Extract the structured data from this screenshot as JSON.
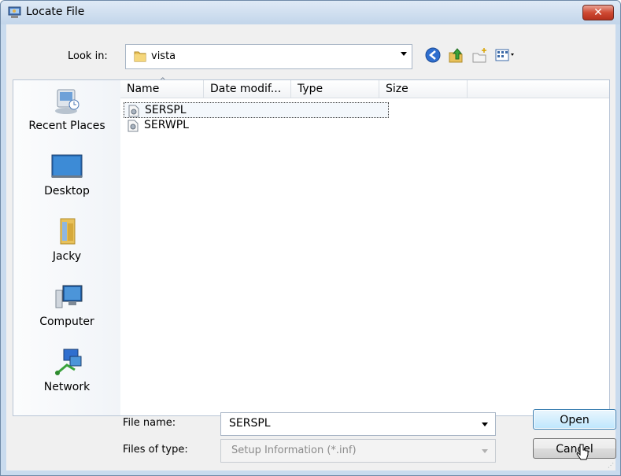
{
  "window": {
    "title": "Locate File",
    "close_label": "✕"
  },
  "toolbar": {
    "look_in_label": "Look in:",
    "look_in_value": "vista",
    "icons": [
      "back-icon",
      "up-folder-icon",
      "new-folder-icon",
      "views-menu-icon"
    ]
  },
  "places": [
    {
      "label": "Recent Places",
      "icon": "recent-places-icon"
    },
    {
      "label": "Desktop",
      "icon": "desktop-icon"
    },
    {
      "label": "Jacky",
      "icon": "user-folder-icon"
    },
    {
      "label": "Computer",
      "icon": "computer-icon"
    },
    {
      "label": "Network",
      "icon": "network-icon"
    }
  ],
  "list": {
    "columns": [
      "Name",
      "Date modif...",
      "Type",
      "Size"
    ],
    "files": [
      {
        "name": "SERSPL",
        "selected": true
      },
      {
        "name": "SERWPL",
        "selected": false
      }
    ]
  },
  "form": {
    "file_name_label": "File name:",
    "file_name_value": "SERSPL",
    "file_type_label": "Files of type:",
    "file_type_value": "Setup Information (*.inf)"
  },
  "buttons": {
    "open": "Open",
    "cancel": "Cancel"
  },
  "colors": {
    "titlebar": "#c9dbee",
    "close": "#cf4a33",
    "open_button": "#bee6fd"
  }
}
